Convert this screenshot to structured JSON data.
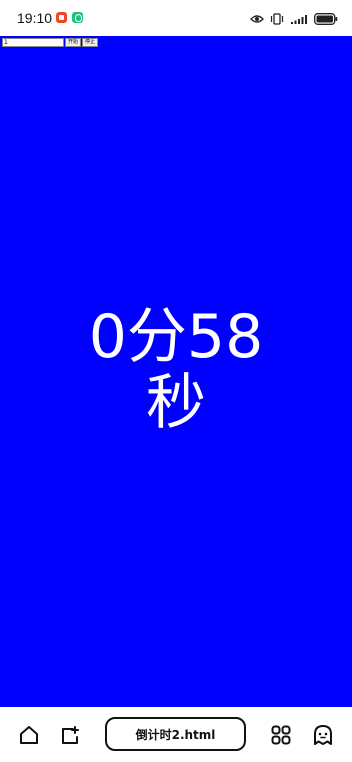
{
  "status_bar": {
    "time": "19:10",
    "app_icons": [
      "video-app-icon",
      "chat-app-icon"
    ],
    "right_icons": [
      "eye-icon",
      "vibrate-icon",
      "signal-icon",
      "battery-icon"
    ]
  },
  "page": {
    "background_color": "#0000ff",
    "input_value": "1",
    "start_button_label": "开始",
    "stop_button_label": "停止",
    "countdown_line1": "0分58",
    "countdown_line2": "秒"
  },
  "bottom_bar": {
    "url_title": "倒计时2.html",
    "icons": [
      "home-icon",
      "tabs-icon",
      "apps-icon",
      "ghost-icon"
    ]
  }
}
